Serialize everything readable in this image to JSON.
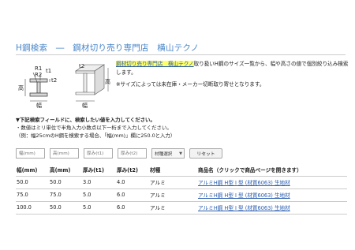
{
  "page": {
    "title": "H鋼検索　―　鋼材切り売り専門店　横山テクノ"
  },
  "diagram": {
    "labels": {
      "r1": "R1",
      "r2": "R2",
      "t1": "t1",
      "t2": "t2",
      "height": "高",
      "width": "幅"
    }
  },
  "intro": {
    "shop_link": "鋼材切り売り専門店　横山テクノ",
    "text": "取り扱いH鋼のサイズ一覧から、幅や高さの値で個別絞り込み検索します。",
    "note": "※サイズによっては未在庫・メーカー切断取り寄せとなります。"
  },
  "instructions": {
    "heading": "▼下記検索フィールドに、検索したい値を入力してください。",
    "line1": "・数値はミリ単位で半角入力小数点以下一桁まで入力してください。",
    "line2": "（例：幅25cmのH鋼を検索する場合、「幅(mm)」欄に250.0と入力）"
  },
  "search": {
    "width_placeholder": "幅(mm)",
    "height_placeholder": "高(mm)",
    "t1_placeholder": "厚み(t1)",
    "t2_placeholder": "厚み(t2)",
    "material_select": "材種選択",
    "reset_label": "リセット"
  },
  "table": {
    "headers": [
      "幅(mm)",
      "高(mm)",
      "厚み(t1)",
      "厚み(t2)",
      "材種",
      "商品名（クリックで商品ページを開きます）"
    ],
    "rows": [
      {
        "width": "50.0",
        "height": "50.0",
        "t1": "3.0",
        "t2": "4.0",
        "material": "アルミ",
        "product": "アルミH鋼 H型 I 型 (材質6063) 生地材"
      },
      {
        "width": "75.0",
        "height": "75.0",
        "t1": "5.0",
        "t2": "6.0",
        "material": "アルミ",
        "product": "アルミH鋼 H型 I 型 (材質6063) 生地材"
      },
      {
        "width": "100.0",
        "height": "50.0",
        "t1": "5.0",
        "t2": "6.0",
        "material": "アルミ",
        "product": "アルミH鋼 H型 I 型 (材質6063) 生地材"
      }
    ]
  }
}
